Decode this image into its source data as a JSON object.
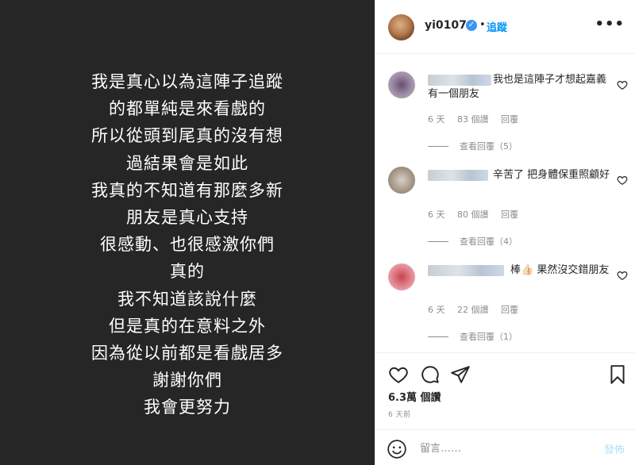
{
  "post": {
    "lines": [
      "我是真心以為這陣子追蹤",
      "的都單純是來看戲的",
      "所以從頭到尾真的沒有想",
      "過結果會是如此",
      "我真的不知道有那麼多新",
      "朋友是真心支持",
      "很感動、也很感激你們",
      "真的",
      "我不知道該說什麼",
      "但是真的在意料之外",
      "因為從以前都是看戲居多",
      "謝謝你們",
      "我會更努力"
    ]
  },
  "header": {
    "username": "yi0107",
    "verified_icon": "verified-badge-icon",
    "separator": "•",
    "follow_label": "追蹤",
    "more_label": "•••"
  },
  "comments": [
    {
      "text": "我也是這陣子才想起嘉義有一個朋友",
      "time": "6 天",
      "likes": "83 個讚",
      "reply": "回覆",
      "view_replies": "查看回覆（5）",
      "avatar_color": "#8a6f86"
    },
    {
      "text": "辛苦了 把身體保重照顧好",
      "time": "6 天",
      "likes": "80 個讚",
      "reply": "回覆",
      "view_replies": "查看回覆（4）",
      "avatar_color": "#b8a99a"
    },
    {
      "text": "棒👍🏻 果然沒交錯朋友",
      "time": "6 天",
      "likes": "22 個讚",
      "reply": "回覆",
      "view_replies": "查看回覆（1）",
      "avatar_color": "#d97a86"
    }
  ],
  "actions": {
    "icons": [
      "heart-icon",
      "comment-icon",
      "share-icon",
      "bookmark-icon"
    ],
    "likes": "6.3萬 個讚",
    "time_ago": "6 天前"
  },
  "add_comment": {
    "placeholder": "留言……",
    "post_label": "發佈"
  },
  "colors": {
    "accent": "#0095f6",
    "image_bg": "#262626",
    "muted": "#8e8e8e"
  }
}
